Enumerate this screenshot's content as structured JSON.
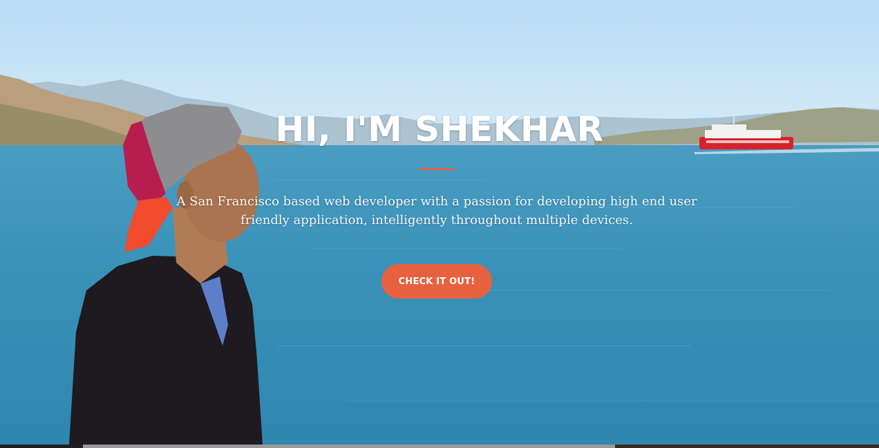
{
  "hero": {
    "title": "HI, I'M SHEKHAR",
    "subtitle": "A San Francisco based web developer with a passion for developing high end user friendly application, intelligently throughout multiple devices.",
    "cta_label": "CHECK IT OUT!"
  },
  "colors": {
    "accent": "#e8613f",
    "sky": "#c9e3f6",
    "water": "#3b93b8",
    "text": "#ffffff"
  },
  "background_image": "photo of a man in a backward cap and dark jacket looking out over San Francisco Bay with hills and a ferry"
}
